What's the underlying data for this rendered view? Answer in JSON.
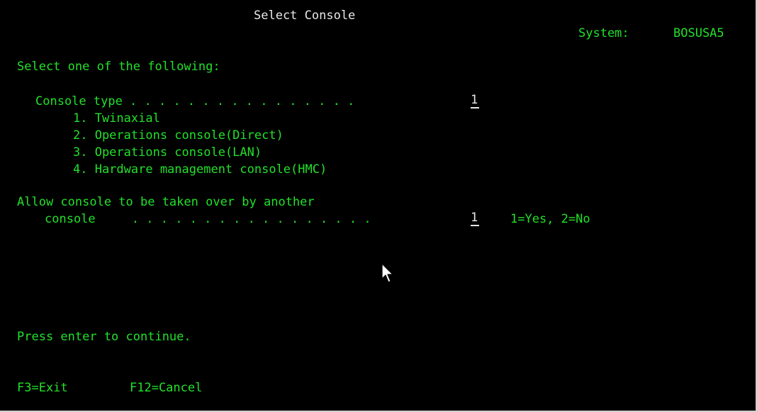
{
  "header": {
    "title": "Select Console",
    "system_label": "System:",
    "system_value": "BOSUSA5"
  },
  "prompt": "Select one of the following:",
  "console_type": {
    "label": "Console type . . . . . . . . . . . . . . . .",
    "value": "1",
    "options": [
      "1. Twinaxial",
      "2. Operations console(Direct)",
      "3. Operations console(LAN)",
      "4. Hardware management console(HMC)"
    ]
  },
  "takeover": {
    "label_line1": "Allow console to be taken over by another",
    "label_line2": "console     . . . . . . . . . . . . . . . . .",
    "value": "1",
    "hint": "1=Yes, 2=No"
  },
  "message": "Press enter to continue.",
  "function_keys": [
    "F3=Exit",
    "F12=Cancel"
  ],
  "colors": {
    "background": "#000000",
    "text_green": "#22e02a",
    "text_white": "#e8e8e8"
  },
  "icons": {
    "mouse_cursor": "arrow-pointer-icon"
  }
}
